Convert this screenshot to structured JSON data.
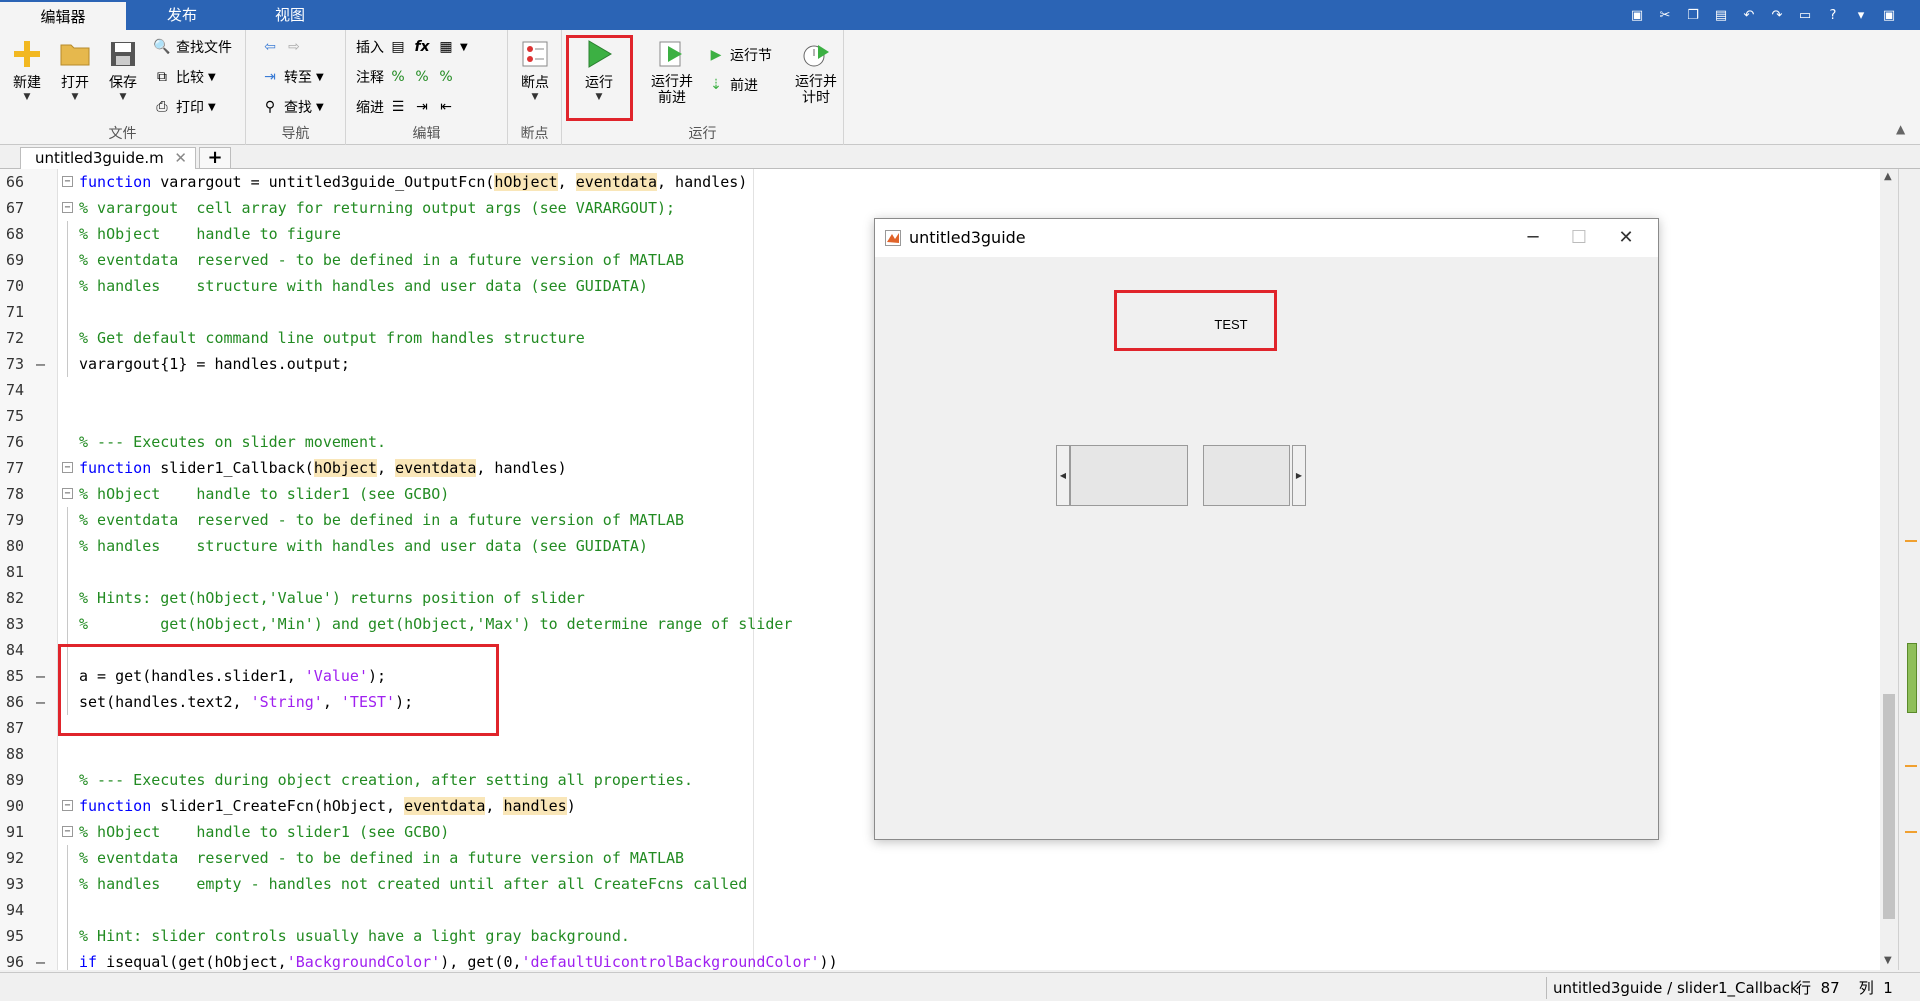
{
  "tabs": {
    "editor": "编辑器",
    "publish": "发布",
    "view": "视图"
  },
  "ribbon": {
    "file": {
      "new": "新建",
      "open": "打开",
      "save": "保存",
      "find_files": "查找文件",
      "compare": "比较",
      "print": "打印",
      "group": "文件"
    },
    "nav": {
      "goto": "转至",
      "find": "查找",
      "group": "导航"
    },
    "edit": {
      "insert": "插入",
      "comment": "注释",
      "indent": "缩进",
      "fx": "fx",
      "group": "编辑"
    },
    "breakpoints": {
      "label": "断点",
      "group": "断点"
    },
    "run": {
      "run": "运行",
      "run_advance": "运行并\n前进",
      "run_section": "运行节",
      "advance": "前进",
      "run_time": "运行并\n计时",
      "group": "运行"
    }
  },
  "doc_tab": "untitled3guide.m",
  "lines": [
    {
      "n": "66",
      "dash": false,
      "fold": "box",
      "html": "<span class=\"kw\">function</span> varargout = untitled3guide_OutputFcn(<span class=\"hl\">hObject</span>, <span class=\"hl\">eventdata</span>, handles)"
    },
    {
      "n": "67",
      "dash": false,
      "fold": "box",
      "html": "<span class=\"cm\">% varargout  cell array for returning output args (see VARARGOUT);</span>"
    },
    {
      "n": "68",
      "dash": false,
      "fold": "line",
      "html": "<span class=\"cm\">% hObject    handle to figure</span>"
    },
    {
      "n": "69",
      "dash": false,
      "fold": "line",
      "html": "<span class=\"cm\">% eventdata  reserved - to be defined in a future version of MATLAB</span>"
    },
    {
      "n": "70",
      "dash": false,
      "fold": "line",
      "html": "<span class=\"cm\">% handles    structure with handles and user data (see GUIDATA)</span>"
    },
    {
      "n": "71",
      "dash": false,
      "fold": "line",
      "html": ""
    },
    {
      "n": "72",
      "dash": false,
      "fold": "line",
      "html": "<span class=\"cm\">% Get default command line output from handles structure</span>"
    },
    {
      "n": "73",
      "dash": true,
      "fold": "line",
      "html": "varargout{1} = handles.output;"
    },
    {
      "n": "74",
      "dash": false,
      "fold": "none",
      "html": ""
    },
    {
      "n": "75",
      "dash": false,
      "fold": "none",
      "html": ""
    },
    {
      "n": "76",
      "dash": false,
      "fold": "none",
      "html": "<span class=\"cm\">% --- Executes on slider movement.</span>"
    },
    {
      "n": "77",
      "dash": false,
      "fold": "box",
      "html": "<span class=\"kw\">function</span> slider1_Callback(<span class=\"hl\">hObject</span>, <span class=\"hl\">eventdata</span>, handles)"
    },
    {
      "n": "78",
      "dash": false,
      "fold": "box",
      "html": "<span class=\"cm\">% hObject    handle to slider1 (see GCBO)</span>"
    },
    {
      "n": "79",
      "dash": false,
      "fold": "line",
      "html": "<span class=\"cm\">% eventdata  reserved - to be defined in a future version of MATLAB</span>"
    },
    {
      "n": "80",
      "dash": false,
      "fold": "line",
      "html": "<span class=\"cm\">% handles    structure with handles and user data (see GUIDATA)</span>"
    },
    {
      "n": "81",
      "dash": false,
      "fold": "line",
      "html": ""
    },
    {
      "n": "82",
      "dash": false,
      "fold": "line",
      "html": "<span class=\"cm\">% Hints: get(hObject,'Value') returns position of slider</span>"
    },
    {
      "n": "83",
      "dash": false,
      "fold": "line",
      "html": "<span class=\"cm\">%        get(hObject,'Min') and get(hObject,'Max') to determine range of slider</span>"
    },
    {
      "n": "84",
      "dash": false,
      "fold": "line",
      "html": ""
    },
    {
      "n": "85",
      "dash": true,
      "fold": "line",
      "html": "a = get(handles.slider1, <span class=\"str\">'Value'</span>);"
    },
    {
      "n": "86",
      "dash": true,
      "fold": "line",
      "html": "set(handles.text2, <span class=\"str\">'String'</span>, <span class=\"str\">'TEST'</span>);"
    },
    {
      "n": "87",
      "dash": false,
      "fold": "none",
      "html": ""
    },
    {
      "n": "88",
      "dash": false,
      "fold": "none",
      "html": ""
    },
    {
      "n": "89",
      "dash": false,
      "fold": "none",
      "html": "<span class=\"cm\">% --- Executes during object creation, after setting all properties.</span>"
    },
    {
      "n": "90",
      "dash": false,
      "fold": "box",
      "html": "<span class=\"kw\">function</span> slider1_CreateFcn(hObject, <span class=\"hl\">eventdata</span>, <span class=\"hl\">handles</span>)"
    },
    {
      "n": "91",
      "dash": false,
      "fold": "box",
      "html": "<span class=\"cm\">% hObject    handle to slider1 (see GCBO)</span>"
    },
    {
      "n": "92",
      "dash": false,
      "fold": "line",
      "html": "<span class=\"cm\">% eventdata  reserved - to be defined in a future version of MATLAB</span>"
    },
    {
      "n": "93",
      "dash": false,
      "fold": "line",
      "html": "<span class=\"cm\">% handles    empty - handles not created until after all CreateFcns called</span>"
    },
    {
      "n": "94",
      "dash": false,
      "fold": "line",
      "html": ""
    },
    {
      "n": "95",
      "dash": false,
      "fold": "line",
      "html": "<span class=\"cm\">% Hint: slider controls usually have a light gray background.</span>"
    },
    {
      "n": "96",
      "dash": true,
      "fold": "line",
      "html": "<span class=\"kw\">if</span> isequal(get(hObject,<span class=\"str\">'BackgroundColor'</span>), get(0,<span class=\"str\">'defaultUicontrolBackgroundColor'</span>))"
    }
  ],
  "figure": {
    "title": "untitled3guide",
    "text": "TEST"
  },
  "status": {
    "func": "untitled3guide / slider1_Callback",
    "row_label": "行",
    "row": "87",
    "col_label": "列",
    "col": "1"
  },
  "colors": {
    "accent": "#2b64b5",
    "highlight_box": "#e0242b",
    "comment": "#228b22",
    "keyword": "#0000ff",
    "string": "#a020f0"
  }
}
